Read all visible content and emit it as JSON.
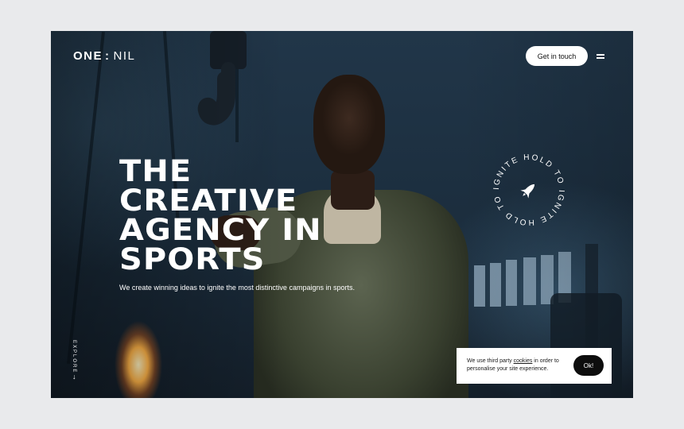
{
  "header": {
    "logo_left": "ONE",
    "logo_sep": ":",
    "logo_right": "NIL",
    "cta_label": "Get in touch",
    "menu_icon": "hamburger-icon"
  },
  "hero": {
    "headline_lines": [
      "THE",
      "CREATIVE",
      "AGENCY IN",
      "SPORTS"
    ],
    "subline": "We create winning ideas to ignite the most distinctive campaigns in sports.",
    "background_image": "athlete-in-industrial-warehouse-photo"
  },
  "badge": {
    "ring_text": "IGNITE HOLD TO IGNITE HOLD TO ",
    "icon": "rocket-icon"
  },
  "explore": {
    "label": "EXPLORE",
    "arrow_icon": "arrow-down-icon"
  },
  "cookie": {
    "text_before": "We use third party ",
    "link_text": "cookies",
    "text_after": " in order to personalise your site experience.",
    "ok_label": "Ok!"
  },
  "colors": {
    "page_bg": "#e9eaec",
    "hero_bg": "#1d2f3f",
    "text_light": "#ffffff",
    "button_dark": "#0d0d0d"
  }
}
